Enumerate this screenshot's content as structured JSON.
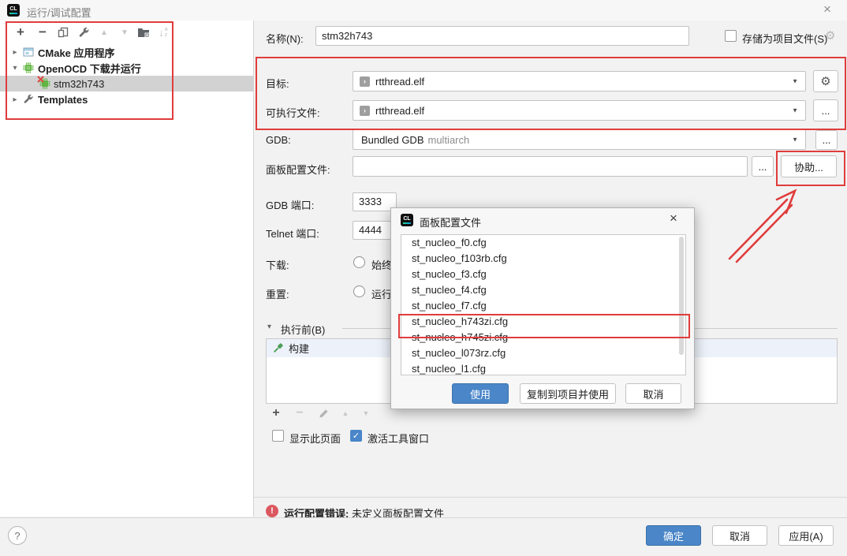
{
  "window": {
    "title": "运行/调试配置"
  },
  "icons": {
    "plus": "+",
    "minus": "−",
    "up": "▲",
    "down": "▼",
    "gear": "⚙",
    "ellipsis": "...",
    "close": "×",
    "chevron_right": "▸",
    "chevron_down": "▾",
    "check": "✓",
    "question": "?",
    "exclamation": "!",
    "sort_arrow": "↓",
    "sort_a": "a",
    "sort_z": "z",
    "combo_chevron": "›"
  },
  "sidebar": {
    "tree": [
      {
        "label": "CMake 应用程序"
      },
      {
        "label": "OpenOCD 下载并运行"
      },
      {
        "label": "stm32h743"
      },
      {
        "label": "Templates"
      }
    ]
  },
  "form": {
    "name_label": "名称(N):",
    "name_value": "stm32h743",
    "store_checkbox_label": "存储为项目文件(S)",
    "target_label": "目标:",
    "target_value": "rtthread.elf",
    "executable_label": "可执行文件:",
    "executable_value": "rtthread.elf",
    "gdb_label": "GDB:",
    "gdb_value": "Bundled GDB",
    "gdb_value_suffix": "multiarch",
    "board_config_label": "面板配置文件:",
    "board_config_value": "",
    "assist_button": "协助...",
    "gdb_port_label": "GDB 端口:",
    "gdb_port_value": "3333",
    "telnet_port_label": "Telnet 端口:",
    "telnet_port_value": "4444",
    "download_label": "下载:",
    "download_option": "始终",
    "reset_label": "重置:",
    "reset_option": "运行",
    "before_launch_label": "执行前(B)",
    "build_item_label": "构建",
    "show_page_checkbox": "显示此页面",
    "activate_tool_checkbox": "激活工具窗口"
  },
  "popup": {
    "title": "面板配置文件",
    "files": [
      "st_nucleo_f0.cfg",
      "st_nucleo_f103rb.cfg",
      "st_nucleo_f3.cfg",
      "st_nucleo_f4.cfg",
      "st_nucleo_f7.cfg",
      "st_nucleo_h743zi.cfg",
      "st_nucleo_h745zi.cfg",
      "st_nucleo_l073rz.cfg",
      "st_nucleo_l1.cfg"
    ],
    "highlighted_file": "st_nucleo_h743zi.cfg",
    "use_button": "使用",
    "copy_use_button": "复制到项目并使用",
    "cancel_button": "取消"
  },
  "footer": {
    "error_prefix": "运行配置错误:",
    "error_message": "未定义面板配置文件",
    "ok_button": "确定",
    "cancel_button": "取消",
    "apply_button": "应用(A)"
  },
  "colors": {
    "accent_blue": "#4a86c8",
    "annotation_red": "#e03c3c",
    "error_red": "#db5860",
    "chip_green": "#62b543",
    "hammer_green": "#4d9e57"
  }
}
